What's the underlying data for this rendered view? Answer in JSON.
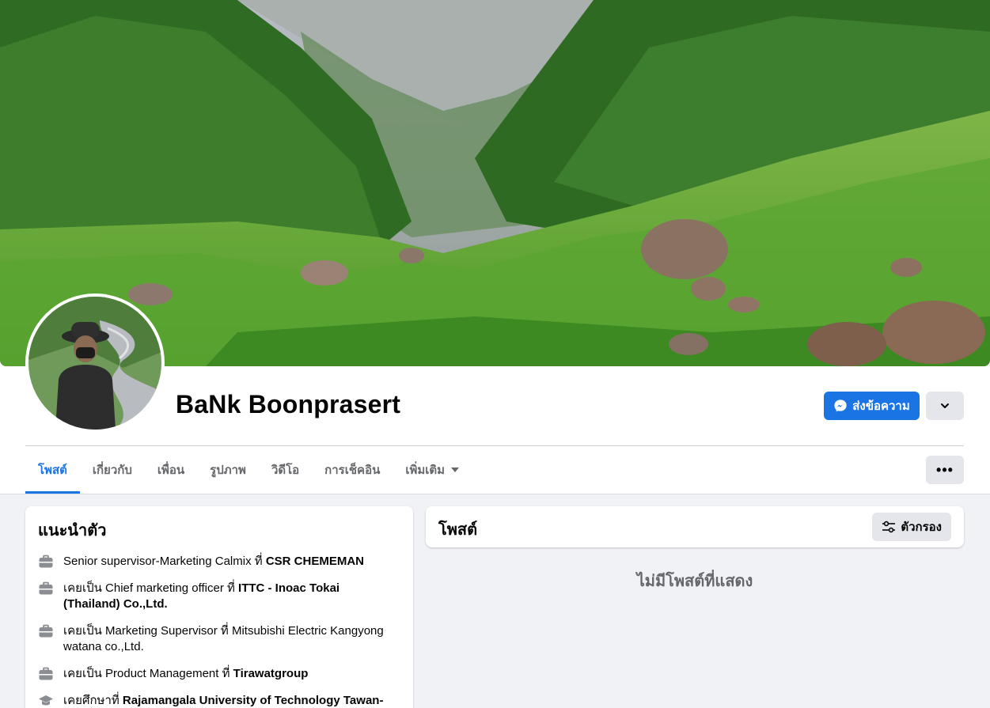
{
  "profile": {
    "name": "BaNk Boonprasert",
    "message_button": "ส่งข้อความ"
  },
  "tabs": [
    {
      "label": "โพสต์",
      "active": true
    },
    {
      "label": "เกี่ยวกับ"
    },
    {
      "label": "เพื่อน"
    },
    {
      "label": "รูปภาพ"
    },
    {
      "label": "วิดีโอ"
    },
    {
      "label": "การเช็คอิน"
    },
    {
      "label": "เพิ่มเติม"
    }
  ],
  "more_dots": "•••",
  "intro": {
    "title": "แนะนำตัว",
    "items": [
      {
        "prefix": "Senior supervisor-Marketing Calmix ที่ ",
        "strong": "CSR CHEMEMAN",
        "icon": "briefcase-icon"
      },
      {
        "prefix": "เคยเป็น Chief marketing officer ที่ ",
        "strong": "ITTC - Inoac Tokai (Thailand) Co.,Ltd.",
        "icon": "briefcase-icon"
      },
      {
        "prefix": "เคยเป็น Marketing Supervisor ที่ Mitsubishi Electric Kangyong watana co.,Ltd.",
        "strong": "",
        "icon": "briefcase-icon"
      },
      {
        "prefix": "เคยเป็น Product Management ที่ ",
        "strong": "Tirawatgroup",
        "icon": "briefcase-icon"
      },
      {
        "prefix": "เคยศึกษาที่ ",
        "strong": "Rajamangala University of Technology Tawan-Ok",
        "icon": "graduation-cap-icon"
      }
    ]
  },
  "posts": {
    "title": "โพสต์",
    "filter_label": "ตัวกรอง",
    "empty_text": "ไม่มีโพสต์ที่แสดง"
  },
  "colors": {
    "accent": "#1b74e4",
    "secondary_text": "#65676b",
    "page_bg": "#f0f2f5"
  }
}
